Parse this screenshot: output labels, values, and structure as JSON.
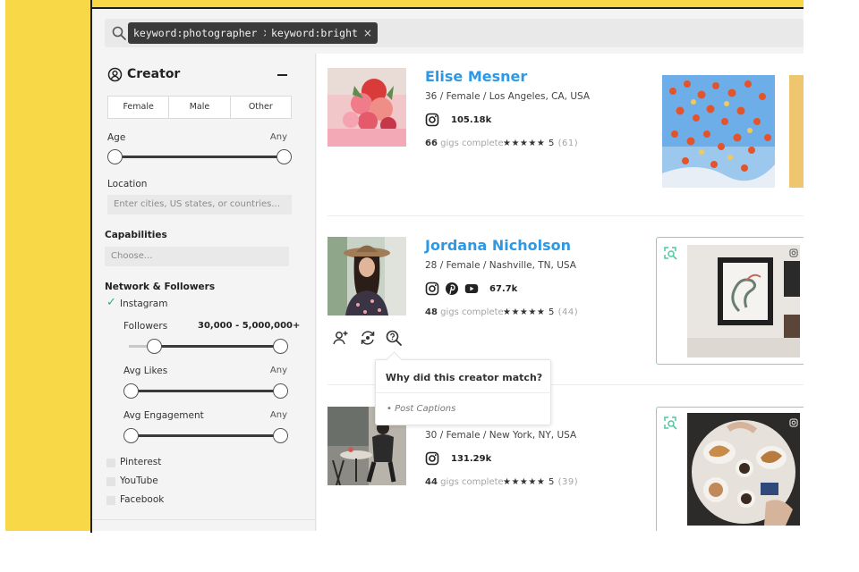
{
  "search": {
    "chips": [
      {
        "label": "keyword:photographer",
        "remove": "×"
      },
      {
        "label": "keyword:bright",
        "remove": "×"
      }
    ]
  },
  "sidebar": {
    "title": "Creator",
    "gender_options": [
      "Female",
      "Male",
      "Other"
    ],
    "age": {
      "label": "Age",
      "value": "Any"
    },
    "location": {
      "label": "Location",
      "placeholder": "Enter cities, US states, or countries..."
    },
    "capabilities": {
      "label": "Capabilities",
      "placeholder": "Choose..."
    },
    "network_header": "Network & Followers",
    "instagram": {
      "label": "Instagram",
      "checked": true,
      "followers": {
        "label": "Followers",
        "value": "30,000 - 5,000,000+"
      },
      "avg_likes": {
        "label": "Avg Likes",
        "value": "Any"
      },
      "avg_engagement": {
        "label": "Avg Engagement",
        "value": "Any"
      }
    },
    "other_networks": [
      "Pinterest",
      "YouTube",
      "Facebook"
    ]
  },
  "results": [
    {
      "name": "Elise Mesner",
      "meta": "36 / Female / Los Angeles, CA, USA",
      "followers": "105.18k",
      "networks": [
        "instagram-icon"
      ],
      "gigs_count": "66",
      "gigs_label": "gigs complete",
      "stars": "★★★★★",
      "rating": "5",
      "reviews": "(61)"
    },
    {
      "name": "Jordana Nicholson",
      "meta": "28 / Female / Nashville, TN, USA",
      "followers": "67.7k",
      "networks": [
        "instagram-icon",
        "pinterest-icon",
        "youtube-icon"
      ],
      "gigs_count": "48",
      "gigs_label": "gigs complete",
      "stars": "★★★★★",
      "rating": "5",
      "reviews": "(44)"
    },
    {
      "name": "",
      "meta": "30 / Female / New York, NY, USA",
      "followers": "131.29k",
      "networks": [
        "instagram-icon"
      ],
      "gigs_count": "44",
      "gigs_label": "gigs complete",
      "stars": "★★★★★",
      "rating": "5",
      "reviews": "(39)"
    }
  ],
  "tooltip": {
    "title": "Why did this creator match?",
    "item": "• Post Captions"
  },
  "colors": {
    "accent_yellow": "#f8d847",
    "name_blue": "#2f98e4",
    "match_green": "#7ed6b5",
    "check_green": "#27b07c"
  }
}
